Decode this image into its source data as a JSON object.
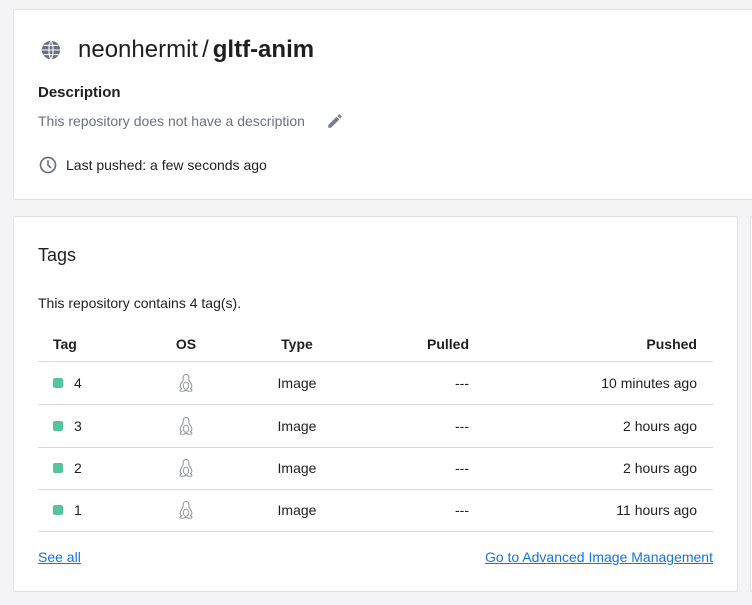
{
  "repo": {
    "namespace": "neonhermit",
    "separator": "/",
    "name": "gltf-anim",
    "description_label": "Description",
    "description_text": "This repository does not have a description",
    "last_pushed": "Last pushed: a few seconds ago"
  },
  "tags": {
    "title": "Tags",
    "count_text": "This repository contains 4 tag(s).",
    "columns": {
      "tag": "Tag",
      "os": "OS",
      "type": "Type",
      "pulled": "Pulled",
      "pushed": "Pushed"
    },
    "rows": [
      {
        "tag": "4",
        "type": "Image",
        "pulled": "---",
        "pushed": "10 minutes ago"
      },
      {
        "tag": "3",
        "type": "Image",
        "pulled": "---",
        "pushed": "2 hours ago"
      },
      {
        "tag": "2",
        "type": "Image",
        "pulled": "---",
        "pushed": "2 hours ago"
      },
      {
        "tag": "1",
        "type": "Image",
        "pulled": "---",
        "pushed": "11 hours ago"
      }
    ],
    "see_all": "See all",
    "advanced_link": "Go to Advanced Image Management"
  },
  "icons": {
    "globe": "globe-icon",
    "pencil": "pencil-icon",
    "clock": "clock-icon",
    "os": "linux-icon",
    "status": "status-dot-icon"
  },
  "colors": {
    "link": "#1473e6",
    "status_dot": "#54c59d",
    "muted_text": "#6b7080"
  }
}
